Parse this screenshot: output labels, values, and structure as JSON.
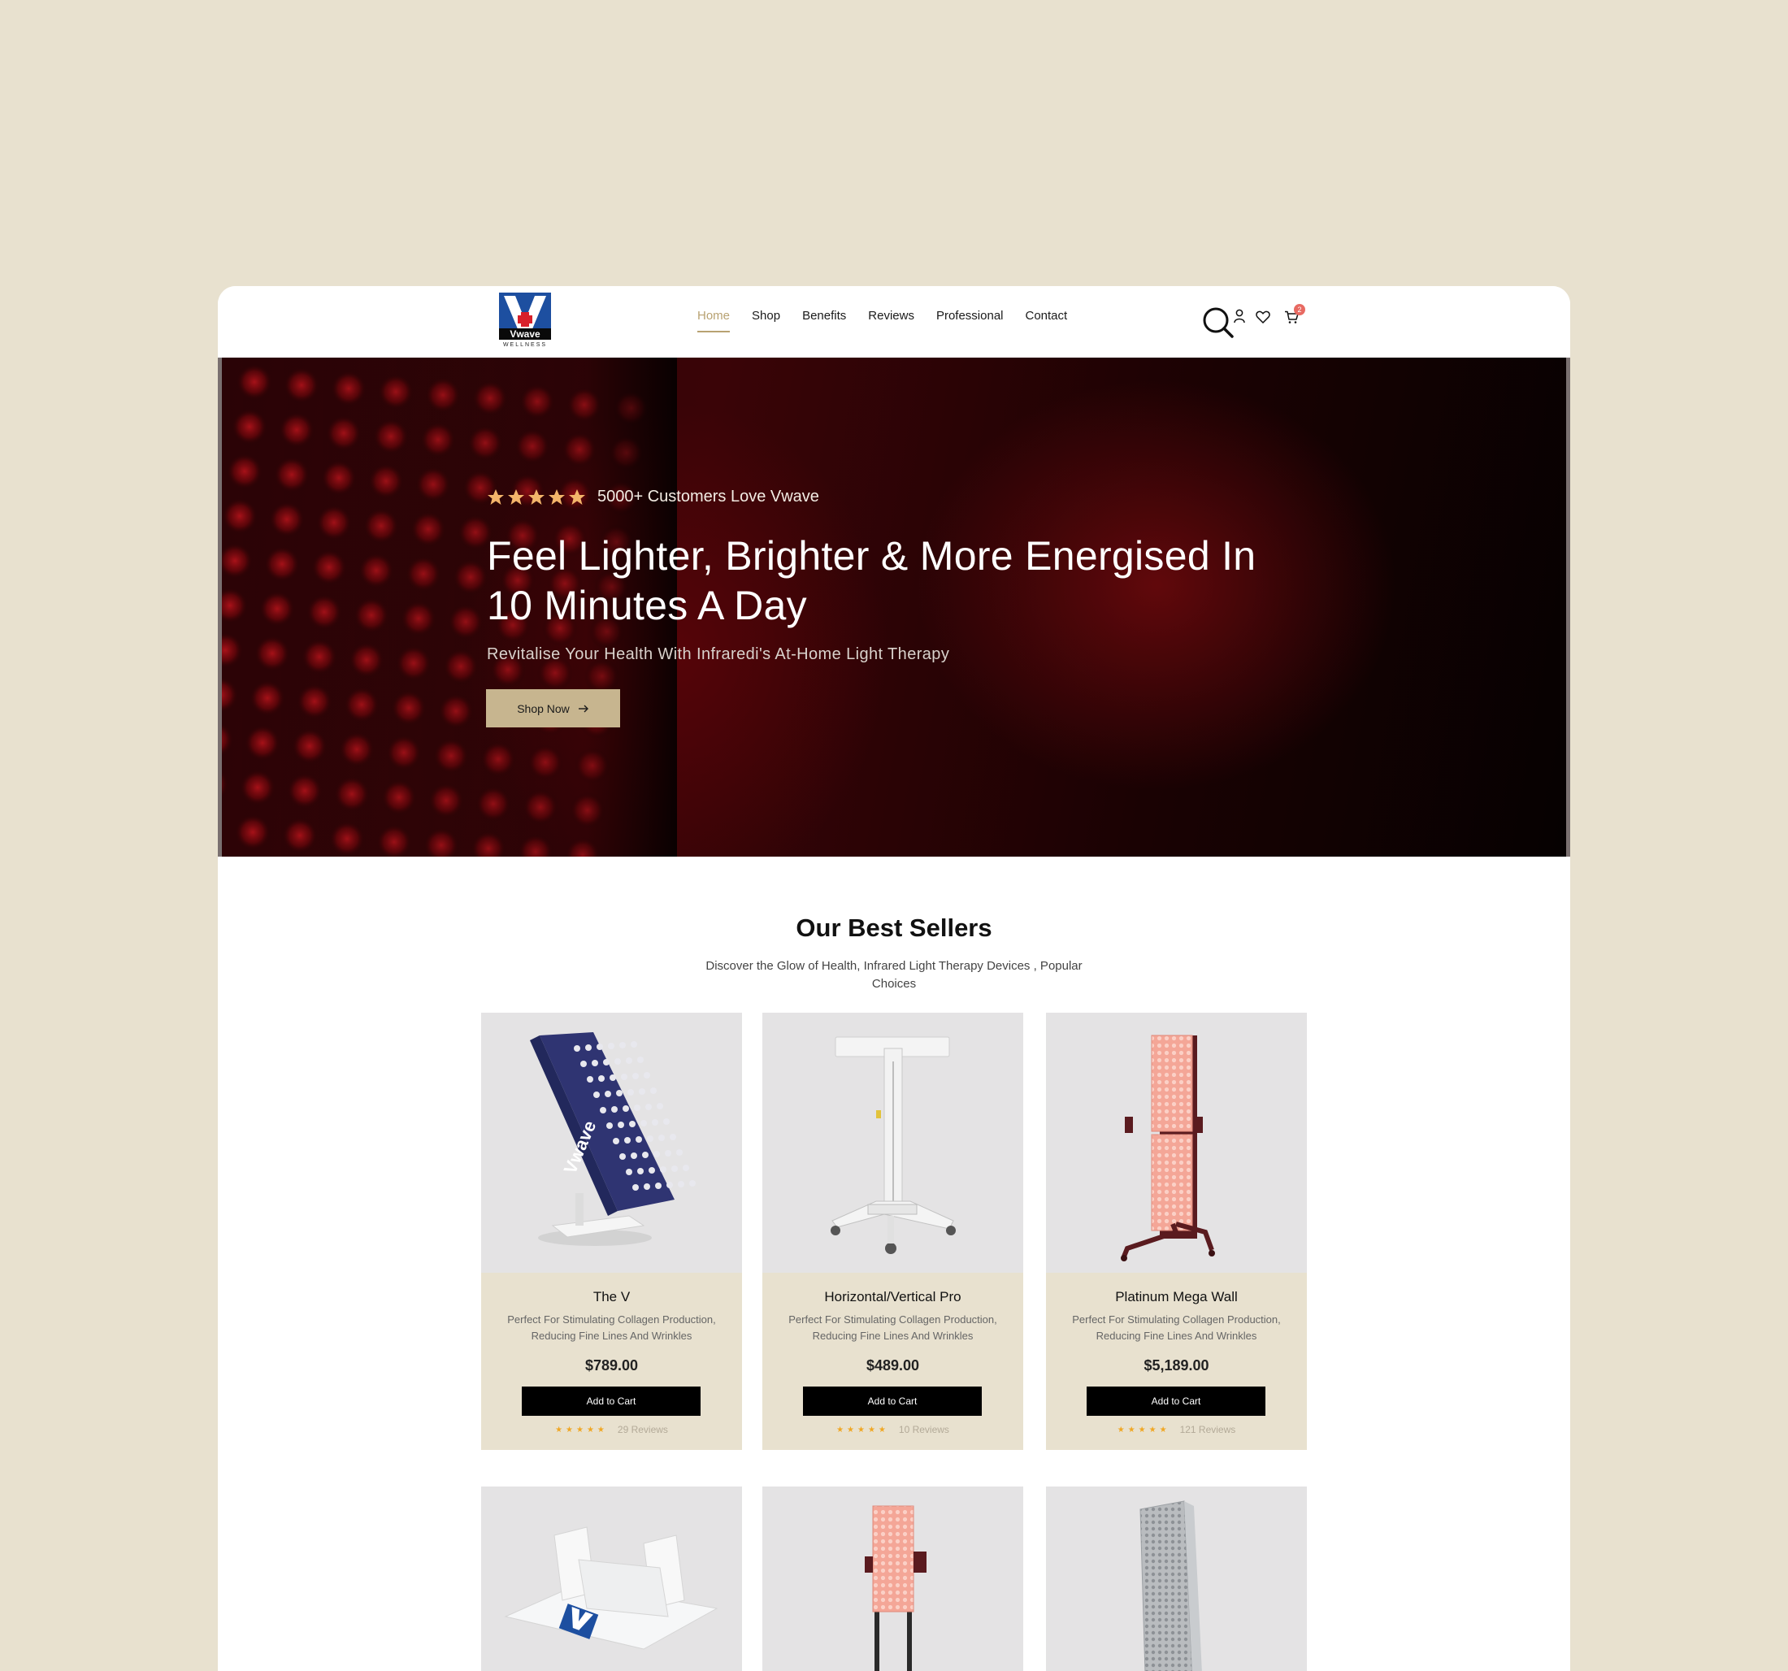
{
  "header": {
    "logo_text": "Vwave",
    "logo_sub": "WELLNESS",
    "nav": [
      "Home",
      "Shop",
      "Benefits",
      "Reviews",
      "Professional",
      "Contact"
    ],
    "cart_count": "2"
  },
  "hero": {
    "rating_text": "5000+ Customers Love Vwave",
    "title": "Feel Lighter, Brighter & More Energised In 10 Minutes A Day",
    "subtitle": "Revitalise Your Health With Infraredi's At-Home Light Therapy",
    "cta": "Shop Now",
    "star_rating": 5
  },
  "best_sellers": {
    "title": "Our Best Sellers",
    "subtitle": "Discover the Glow of Health, Infrared Light Therapy Devices , Popular Choices",
    "products": [
      {
        "name": "The V",
        "desc": "Perfect For Stimulating Collagen Production, Reducing Fine Lines And Wrinkles",
        "price": "$789.00",
        "cart": "Add to Cart",
        "reviews": "29 Reviews"
      },
      {
        "name": "Horizontal/Vertical Pro",
        "desc": "Perfect For Stimulating Collagen Production, Reducing Fine Lines And Wrinkles",
        "price": "$489.00",
        "cart": "Add to Cart",
        "reviews": "10 Reviews"
      },
      {
        "name": "Platinum Mega Wall",
        "desc": "Perfect For Stimulating Collagen Production, Reducing Fine Lines And Wrinkles",
        "price": "$5,189.00",
        "cart": "Add to Cart",
        "reviews": "121 Reviews"
      }
    ]
  },
  "colors": {
    "page_bg": "#e8e1cf",
    "accent": "#c7b58f",
    "nav_active": "#b8a272",
    "star": "#f0a724",
    "badge": "#e86a62"
  }
}
